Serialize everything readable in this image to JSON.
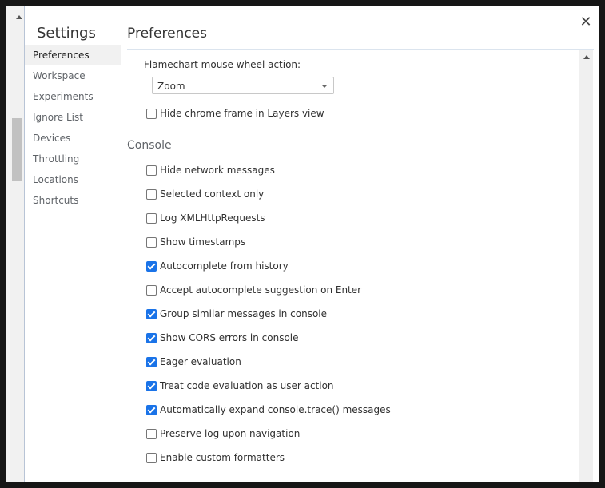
{
  "dialog": {
    "sidebar_title": "Settings",
    "close_icon": "close-icon"
  },
  "sidebar": {
    "items": [
      {
        "label": "Preferences",
        "selected": true
      },
      {
        "label": "Workspace"
      },
      {
        "label": "Experiments"
      },
      {
        "label": "Ignore List"
      },
      {
        "label": "Devices"
      },
      {
        "label": "Throttling"
      },
      {
        "label": "Locations"
      },
      {
        "label": "Shortcuts"
      }
    ]
  },
  "main": {
    "title": "Preferences",
    "flamechart_label": "Flamechart mouse wheel action:",
    "flamechart_value": "Zoom",
    "hide_chrome_frame": {
      "label": "Hide chrome frame in Layers view",
      "checked": false
    },
    "console_title": "Console",
    "console_options": [
      {
        "label": "Hide network messages",
        "checked": false
      },
      {
        "label": "Selected context only",
        "checked": false
      },
      {
        "label": "Log XMLHttpRequests",
        "checked": false
      },
      {
        "label": "Show timestamps",
        "checked": false
      },
      {
        "label": "Autocomplete from history",
        "checked": true
      },
      {
        "label": "Accept autocomplete suggestion on Enter",
        "checked": false
      },
      {
        "label": "Group similar messages in console",
        "checked": true
      },
      {
        "label": "Show CORS errors in console",
        "checked": true
      },
      {
        "label": "Eager evaluation",
        "checked": true
      },
      {
        "label": "Treat code evaluation as user action",
        "checked": true
      },
      {
        "label": "Automatically expand console.trace() messages",
        "checked": true
      },
      {
        "label": "Preserve log upon navigation",
        "checked": false
      },
      {
        "label": "Enable custom formatters",
        "checked": false
      }
    ]
  },
  "colors": {
    "accent": "#1a73e8"
  }
}
